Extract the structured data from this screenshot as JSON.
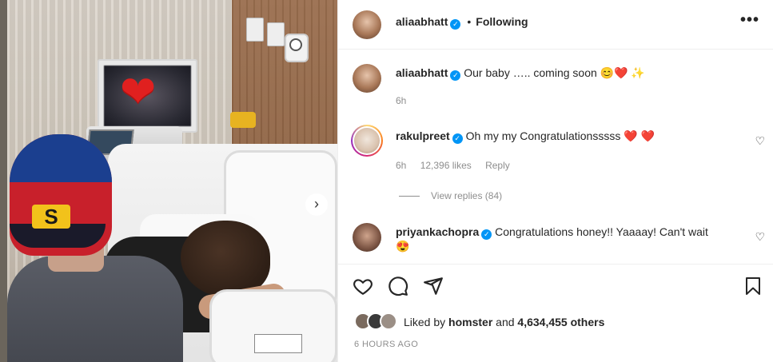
{
  "post": {
    "author": "aliaabhatt",
    "follow_status": "Following",
    "caption": "Our baby ….. coming soon 😊❤️ ✨",
    "caption_time": "6h",
    "more_label": "•••"
  },
  "comments": [
    {
      "user": "rakulpreet",
      "text": "Oh my my Congratulationsssss ❤️ ❤️",
      "time": "6h",
      "likes": "12,396 likes",
      "reply": "Reply",
      "view_replies": "View replies (84)"
    },
    {
      "user": "priyankachopra",
      "text": "Congratulations honey!! Yaaaay! Can't wait",
      "emoji": "😍"
    }
  ],
  "engagement": {
    "liked_by_prefix": "Liked by",
    "liked_by_user": "homster",
    "and_label": "and",
    "others": "4,634,455 others",
    "timestamp": "6 HOURS AGO"
  },
  "photo": {
    "next_glyph": "›",
    "heart_glyph": "❤",
    "cap_logo": "S"
  },
  "icons": {
    "heart": "heart-icon",
    "comment": "comment-icon",
    "share": "share-icon",
    "bookmark": "bookmark-icon",
    "verified": "verified-badge-icon"
  },
  "colors": {
    "verified_blue": "#0095f6",
    "heart_red": "#e0201f",
    "muted_text": "#8e8e8e"
  }
}
